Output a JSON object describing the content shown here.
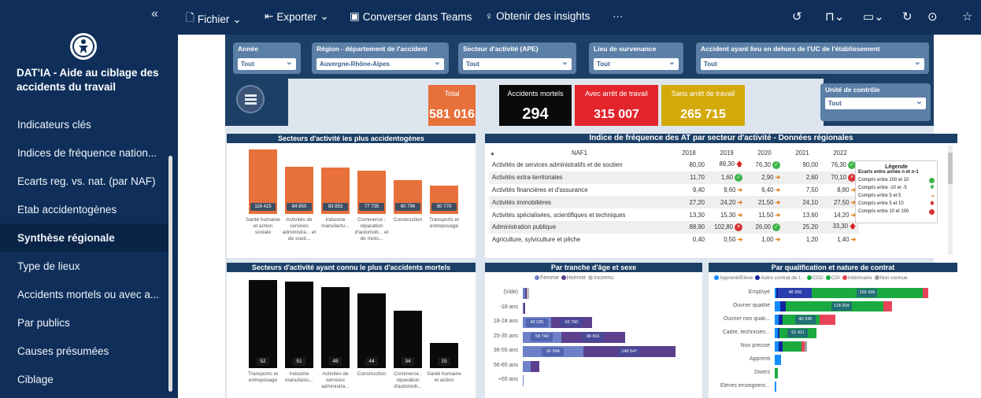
{
  "sidebar": {
    "collapse_icon": "«",
    "title": "DAT'IA - Aide au ciblage des accidents du travail",
    "items": [
      {
        "label": "Indicateurs clés",
        "active": false
      },
      {
        "label": "Indices de fréquence nation...",
        "active": false
      },
      {
        "label": "Ecarts reg. vs. nat. (par NAF)",
        "active": false
      },
      {
        "label": "Etab accidentogènes",
        "active": false
      },
      {
        "label": "Synthèse régionale",
        "active": true
      },
      {
        "label": "Type de lieux",
        "active": false
      },
      {
        "label": "Accidents mortels ou avec a...",
        "active": false
      },
      {
        "label": "Par publics",
        "active": false
      },
      {
        "label": "Causes présumées",
        "active": false
      },
      {
        "label": "Ciblage",
        "active": false
      }
    ]
  },
  "toolbar": {
    "file": "Fichier",
    "export": "Exporter",
    "teams": "Converser dans Teams",
    "insights": "Obtenir des insights",
    "more": "···"
  },
  "filters": {
    "annee": {
      "label": "Année",
      "value": "Tout"
    },
    "region": {
      "label": "Région - département de l'accident",
      "value": "Auvergne-Rhône-Alpes"
    },
    "secteur": {
      "label": "Secteur d'activité (APE)",
      "value": "Tout"
    },
    "lieu": {
      "label": "Lieu de survenance",
      "value": "Tout"
    },
    "hors_uc": {
      "label": "Accident ayant lieu en dehors de l'UC de l'établissement",
      "value": "Tout"
    },
    "unite": {
      "label": "Unité de contrôle",
      "value": "Tout"
    }
  },
  "kpis": {
    "total": {
      "label": "Total",
      "value": "581 016",
      "color": "#e8703a"
    },
    "mortels": {
      "label": "Accidents mortels",
      "value": "294",
      "color": "#0a0a0a"
    },
    "avec_arret": {
      "label": "Avec arrêt de travail",
      "value": "315 007",
      "color": "#e3242b"
    },
    "sans_arret": {
      "label": "Sans arrêt de travail",
      "value": "265 715",
      "color": "#d4a90a"
    }
  },
  "sectors_accidents": {
    "title": "Secteurs d'activité les plus accidentogènes",
    "bars": [
      {
        "value": 116415,
        "label": "116 415",
        "category": "Santé humaine et action sociale"
      },
      {
        "value": 84850,
        "label": "84 850",
        "category": "Activités de services administra... et de souti..."
      },
      {
        "value": 83853,
        "label": "83 853",
        "category": "Industrie manufactu..."
      },
      {
        "value": 77735,
        "label": "77 735",
        "category": "Commerce ; réparation d'automob... et de moto..."
      },
      {
        "value": 60796,
        "label": "60 796",
        "category": "Construction"
      },
      {
        "value": 50770,
        "label": "50 770",
        "category": "Transports et entreposage"
      }
    ]
  },
  "freq_index": {
    "title": "Indice de fréquence des AT par secteur d'activité - Données régionales",
    "header": [
      "NAF1",
      "2018",
      "2019",
      "2020",
      "2021",
      "2022"
    ],
    "rows": [
      {
        "naf": "Activités de services administratifs et de soutien",
        "v": [
          "80,00",
          "89,30",
          "76,30",
          "90,00",
          "76,30"
        ],
        "i": [
          "",
          "up",
          "g",
          "",
          "g"
        ]
      },
      {
        "naf": "Activités extra-territoriales",
        "v": [
          "11,70",
          "1,60",
          "2,90",
          "2,60",
          "70,10"
        ],
        "i": [
          "",
          "g",
          "arr",
          "",
          "r"
        ]
      },
      {
        "naf": "Activités financières et d'assurance",
        "v": [
          "9,40",
          "9,60",
          "6,40",
          "7,50",
          "8,80"
        ],
        "i": [
          "",
          "arr",
          "arr",
          "",
          "arr"
        ]
      },
      {
        "naf": "Activités immobilières",
        "v": [
          "27,20",
          "24,20",
          "21,50",
          "24,10",
          "27,50"
        ],
        "i": [
          "",
          "arr",
          "arr",
          "",
          "arr"
        ]
      },
      {
        "naf": "Activités spécialisées, scientifiques et techniques",
        "v": [
          "13,30",
          "15,30",
          "11,50",
          "13,60",
          "14,20"
        ],
        "i": [
          "",
          "arr",
          "arr",
          "",
          "arr"
        ]
      },
      {
        "naf": "Administration publique",
        "v": [
          "88,90",
          "102,80",
          "26,00",
          "25,20",
          "33,30"
        ],
        "i": [
          "",
          "r",
          "g",
          "",
          "up"
        ]
      },
      {
        "naf": "Agriculture, sylviculture et pêche",
        "v": [
          "0,40",
          "0,50",
          "1,00",
          "1,20",
          "1,40"
        ],
        "i": [
          "",
          "arr",
          "arr",
          "",
          "arr"
        ]
      }
    ],
    "legend": {
      "title": "Légende",
      "subtitle": "Ecarts entre année n et n-1",
      "items": [
        {
          "text": "Compris entre 100 et 10",
          "icon": "g"
        },
        {
          "text": "Compris entre -10 et -5",
          "icon": "down"
        },
        {
          "text": "Compris entre 5 et 5",
          "icon": "arr"
        },
        {
          "text": "Compris entre 5 et 10",
          "icon": "up"
        },
        {
          "text": "Compris entre 10 et 100",
          "icon": "r"
        }
      ]
    }
  },
  "sectors_mortels": {
    "title": "Secteurs d'activité ayant connu le plus d'accidents mortels",
    "bars": [
      {
        "value": 52,
        "label": "52",
        "category": "Transports et entreposage"
      },
      {
        "value": 51,
        "label": "51",
        "category": "Industrie manufactu..."
      },
      {
        "value": 48,
        "label": "48",
        "category": "Activités de services administra..."
      },
      {
        "value": 44,
        "label": "44",
        "category": "Construction"
      },
      {
        "value": 34,
        "label": "34",
        "category": "Commerce ; réparation d'automob..."
      },
      {
        "value": 15,
        "label": "15",
        "category": "Santé humaine et action"
      }
    ]
  },
  "age_sexe": {
    "title": "Par tranche d'âge et sexe",
    "legend": [
      {
        "name": "Femme",
        "color": "#6f82c9"
      },
      {
        "name": "Homme",
        "color": "#5b3f8c"
      },
      {
        "name": "Inconnu",
        "color": "#bdbdbd"
      }
    ],
    "rows": [
      {
        "age": "(Vide)",
        "femme": 3000,
        "homme": 3000,
        "inconnu": 3500,
        "fl": "",
        "hl": ""
      },
      {
        "age": "-18 ans",
        "femme": 1500,
        "homme": 1500,
        "inconnu": 0,
        "fl": "",
        "hl": ""
      },
      {
        "age": "18-24 ans",
        "femme": 43035,
        "homme": 62790,
        "inconnu": 0,
        "fl": "43 035",
        "hl": "62 790"
      },
      {
        "age": "25-35 ans",
        "femme": 58740,
        "homme": 96801,
        "inconnu": 0,
        "fl": "58 740",
        "hl": "96 801"
      },
      {
        "age": "36-55 ans",
        "femme": 92094,
        "homme": 140547,
        "inconnu": 0,
        "fl": "92 094",
        "hl": "140 547"
      },
      {
        "age": "56-65 ans",
        "femme": 12000,
        "homme": 13000,
        "inconnu": 0,
        "fl": "",
        "hl": ""
      },
      {
        "age": "+65 ans",
        "femme": 1500,
        "homme": 0,
        "inconnu": 0,
        "fl": "",
        "hl": ""
      }
    ]
  },
  "qualif": {
    "title": "Par qualification et nature de contrat",
    "legend": [
      {
        "name": "Apprenti/Elève",
        "color": "#118dff"
      },
      {
        "name": "Autre contrat de t...",
        "color": "#12239e"
      },
      {
        "name": "CDD",
        "color": "#1aab40"
      },
      {
        "name": "CDI",
        "color": "#1aab40"
      },
      {
        "name": "Intérimaire",
        "color": "#e8455a"
      },
      {
        "name": "Non connue",
        "color": "#a0a0a0"
      }
    ],
    "rows": [
      {
        "q": "Employé",
        "segs": [
          {
            "w": 5,
            "c": "#118dff"
          },
          {
            "w": 10,
            "c": "#12239e"
          },
          {
            "w": 48266,
            "c": "#2a3eb1",
            "l": "48 266"
          },
          {
            "w": 155436,
            "c": "#1aab40",
            "l": "155 436"
          },
          {
            "w": 8000,
            "c": "#e8455a"
          }
        ]
      },
      {
        "q": "Ouvrier qualifié",
        "segs": [
          {
            "w": 8000,
            "c": "#118dff"
          },
          {
            "w": 7000,
            "c": "#12239e"
          },
          {
            "w": 20000,
            "c": "#1aab40"
          },
          {
            "w": 118204,
            "c": "#1aab40",
            "l": "118 204"
          },
          {
            "w": 12000,
            "c": "#e8455a"
          }
        ]
      },
      {
        "q": "Ouvrier non quali...",
        "segs": [
          {
            "w": 6000,
            "c": "#118dff"
          },
          {
            "w": 5000,
            "c": "#12239e"
          },
          {
            "w": 12000,
            "c": "#1aab40"
          },
          {
            "w": 40249,
            "c": "#1aab40",
            "l": "40 249"
          },
          {
            "w": 22000,
            "c": "#e8455a"
          }
        ]
      },
      {
        "q": "Cadre, technicien...",
        "segs": [
          {
            "w": 4000,
            "c": "#118dff"
          },
          {
            "w": 3000,
            "c": "#12239e"
          },
          {
            "w": 51411,
            "c": "#1aab40",
            "l": "51 411"
          }
        ]
      },
      {
        "q": "Non précisé",
        "segs": [
          {
            "w": 5000,
            "c": "#118dff"
          },
          {
            "w": 6000,
            "c": "#12239e"
          },
          {
            "w": 15000,
            "c": "#1aab40"
          },
          {
            "w": 12000,
            "c": "#1aab40"
          },
          {
            "w": 4000,
            "c": "#e8455a"
          },
          {
            "w": 3000,
            "c": "#a0a0a0"
          }
        ]
      },
      {
        "q": "Apprenti",
        "segs": [
          {
            "w": 9000,
            "c": "#118dff"
          }
        ]
      },
      {
        "q": "Divers",
        "segs": [
          {
            "w": 4000,
            "c": "#1aab40"
          }
        ]
      },
      {
        "q": "Elèves enseignem...",
        "segs": [
          {
            "w": 2500,
            "c": "#118dff"
          }
        ]
      }
    ]
  }
}
